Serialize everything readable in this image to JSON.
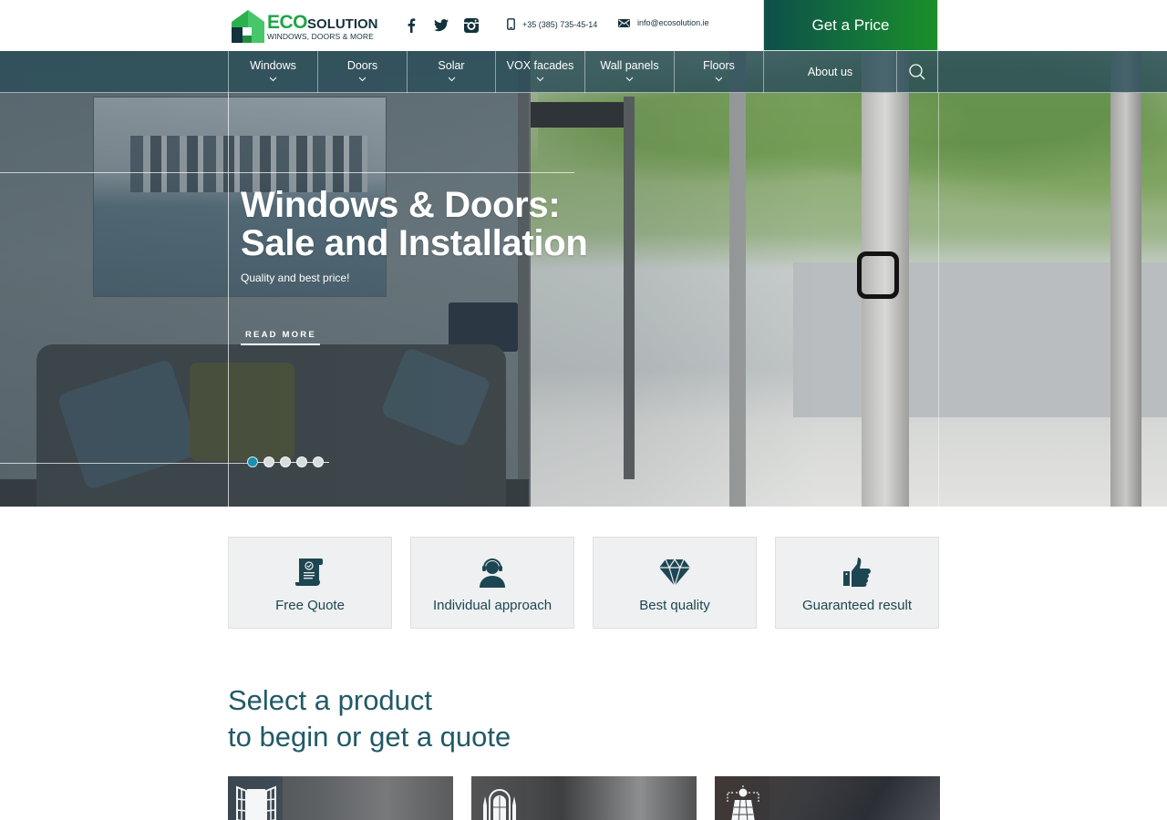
{
  "header": {
    "logo": {
      "brand_primary": "ECO",
      "brand_secondary": "SOLUTION",
      "tagline": "WINDOWS, DOORS & MORE"
    },
    "socials": [
      {
        "icon": "facebook-icon",
        "label": "Facebook"
      },
      {
        "icon": "twitter-icon",
        "label": "Twitter"
      },
      {
        "icon": "instagram-icon",
        "label": "Instagram"
      }
    ],
    "phone": "+35 (385) 735-45-14",
    "email": "info@ecosolution.ie",
    "cta_label": "Get a Price"
  },
  "nav": {
    "items": [
      {
        "label": "Windows",
        "has_dropdown": true
      },
      {
        "label": "Doors",
        "has_dropdown": true
      },
      {
        "label": "Solar",
        "has_dropdown": true
      },
      {
        "label": "VOX facades",
        "has_dropdown": true
      },
      {
        "label": "Wall panels",
        "has_dropdown": true
      },
      {
        "label": "Floors",
        "has_dropdown": true
      },
      {
        "label": "About us",
        "has_dropdown": false
      }
    ],
    "search_icon": "search-icon"
  },
  "hero": {
    "title_line1": "Windows & Doors:",
    "title_line2": "Sale and Installation",
    "subtitle": "Quality and best price!",
    "cta_label": "READ MORE",
    "slides_total": 5,
    "active_slide": 1
  },
  "features": [
    {
      "icon": "document-icon",
      "label": "Free Quote"
    },
    {
      "icon": "headset-icon",
      "label": "Individual approach"
    },
    {
      "icon": "diamond-icon",
      "label": "Best quality"
    },
    {
      "icon": "thumbs-up-icon",
      "label": "Guaranteed result"
    }
  ],
  "products_section": {
    "title_line1": "Select a product",
    "title_line2": "to begin or get a quote",
    "cards": [
      {
        "icon": "window-icon"
      },
      {
        "icon": "door-icon"
      },
      {
        "icon": "solar-panel-icon"
      }
    ]
  },
  "colors": {
    "brand_green": "#1ea546",
    "brand_dark": "#14323c",
    "accent_teal": "#215a66",
    "slider_active": "#1a8fb0"
  }
}
